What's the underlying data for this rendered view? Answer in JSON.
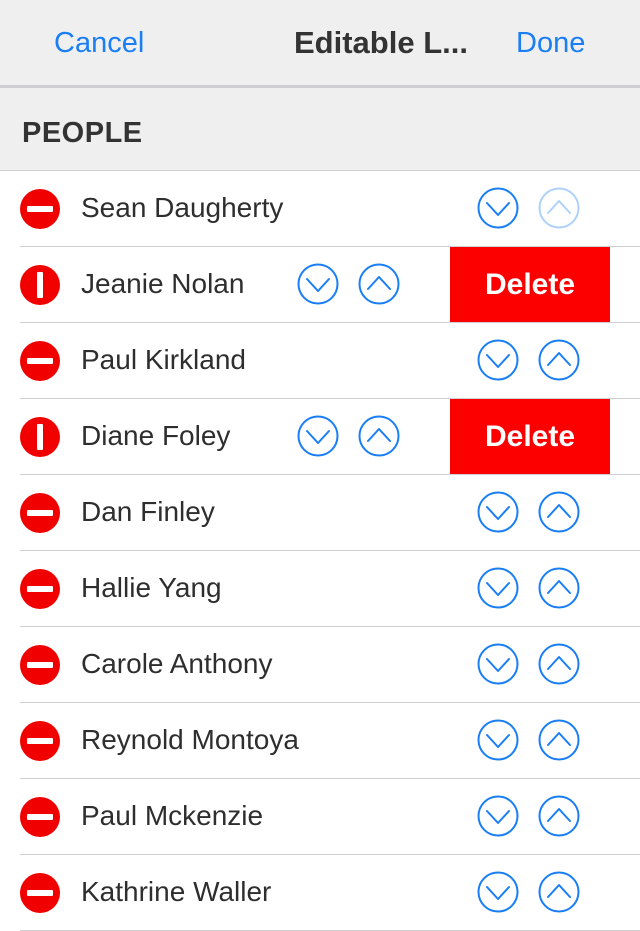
{
  "navbar": {
    "cancel_label": "Cancel",
    "title": "Editable L...",
    "done_label": "Done"
  },
  "section": {
    "title": "PEOPLE"
  },
  "delete_label": "Delete",
  "colors": {
    "accent": "#1a7ef5",
    "delete_red": "#fc0000",
    "remove_icon_red": "#f10000",
    "header_bg": "#efeff0"
  },
  "rows": [
    {
      "name": "Sean Daugherty",
      "delete_confirm": false,
      "up_enabled": false,
      "down_enabled": true
    },
    {
      "name": "Jeanie Nolan",
      "delete_confirm": true,
      "up_enabled": true,
      "down_enabled": true
    },
    {
      "name": "Paul Kirkland",
      "delete_confirm": false,
      "up_enabled": true,
      "down_enabled": true
    },
    {
      "name": "Diane Foley",
      "delete_confirm": true,
      "up_enabled": true,
      "down_enabled": true
    },
    {
      "name": "Dan Finley",
      "delete_confirm": false,
      "up_enabled": true,
      "down_enabled": true
    },
    {
      "name": "Hallie Yang",
      "delete_confirm": false,
      "up_enabled": true,
      "down_enabled": true
    },
    {
      "name": "Carole Anthony",
      "delete_confirm": false,
      "up_enabled": true,
      "down_enabled": true
    },
    {
      "name": "Reynold Montoya",
      "delete_confirm": false,
      "up_enabled": true,
      "down_enabled": true
    },
    {
      "name": "Paul Mckenzie",
      "delete_confirm": false,
      "up_enabled": true,
      "down_enabled": true
    },
    {
      "name": "Kathrine Waller",
      "delete_confirm": false,
      "up_enabled": true,
      "down_enabled": true
    }
  ]
}
